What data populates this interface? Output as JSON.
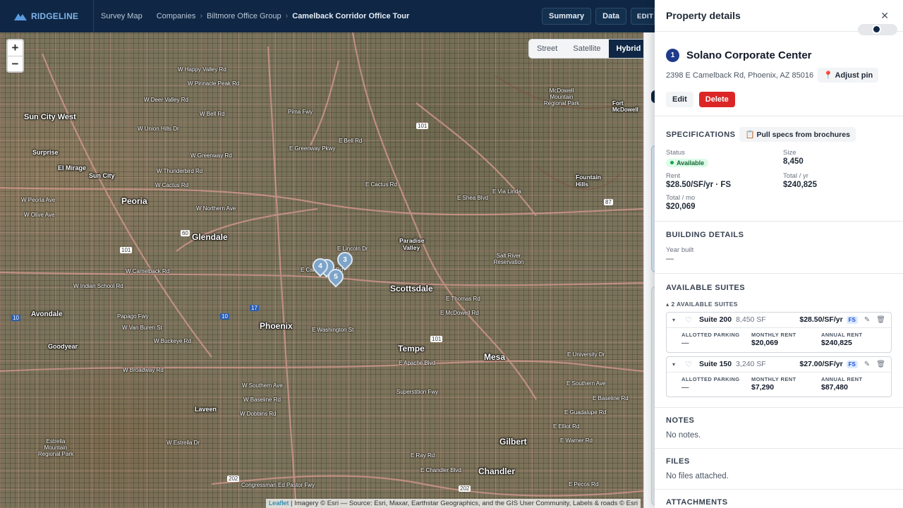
{
  "app": {
    "name": "RIDGELINE"
  },
  "breadcrumb": {
    "root": "Survey Map",
    "items": [
      "Companies",
      "Biltmore Office Group"
    ],
    "current": "Camelback Corridor Office Tour",
    "separator": "›"
  },
  "topbar": {
    "summary": "Summary",
    "data": "Data",
    "edit": "EDIT"
  },
  "map": {
    "zoom_in": "+",
    "zoom_out": "−",
    "layers": [
      "Street",
      "Satellite",
      "Hybrid"
    ],
    "active_layer": "Hybrid",
    "cities": [
      "Sun City West",
      "Surprise",
      "El Mirage",
      "Sun City",
      "Peoria",
      "Glendale",
      "Phoenix",
      "Avondale",
      "Goodyear",
      "Tempe",
      "Mesa",
      "Scottsdale",
      "Paradise Valley",
      "Gilbert",
      "Chandler",
      "Laveen",
      "Fort McDowell",
      "Fountain Hills"
    ],
    "streets": [
      "W Happy Valley Rd",
      "W Pinnacle Peak Rd",
      "W Deer Valley Rd",
      "W Union Hills Dr",
      "W Bell Rd",
      "W Greenway Rd",
      "W Thunderbird Rd",
      "W Cactus Rd",
      "W Peoria Ave",
      "W Olive Ave",
      "W Northern Ave",
      "W Camelback Rd",
      "W Indian School Rd",
      "Papago Fwy",
      "W Van Buren St",
      "W Buckeye Rd",
      "W Broadway Rd",
      "W Southern Ave",
      "W Baseline Rd",
      "W Dobbins Rd",
      "Congressman Ed Pastor Fwy",
      "E Camelback Rd",
      "E Lincoln Dr",
      "E Shea Blvd",
      "E Via Linda",
      "E Bell Rd",
      "E Cactus Rd",
      "E Thomas Rd",
      "E McDowell Rd",
      "E Washington St",
      "E Apache Blvd",
      "E University Dr",
      "E Southern Ave",
      "E Baseline Rd",
      "E Guadalupe Rd",
      "E Elliot Rd",
      "E Warner Rd",
      "E Ray Rd",
      "E Chandler Blvd",
      "E Pecos Rd",
      "Pima Fwy",
      "E Greenway Pkwy",
      "Superstition Fwy",
      "McDowell Mountain Regional Park",
      "Salt River Reservation",
      "Estrella Mountain Regional Park",
      "W Estrella Dr"
    ],
    "highway_shields": [
      "101",
      "101",
      "60",
      "10",
      "17",
      "10",
      "202",
      "87",
      "202",
      "101"
    ],
    "pins": [
      "3",
      "4",
      "5"
    ],
    "attribution_link": "Leaflet",
    "attribution": "| Imagery © Esri — Source: Esri, Maxar, Earthstar Geographics, and the GIS User Community, Labels & roads © Esri"
  },
  "panel": {
    "title": "Property details",
    "close": "✕",
    "property": {
      "number": "1",
      "name": "Solano Corporate Center",
      "address": "2398 E Camelback Rd, Phoenix, AZ 85016",
      "adjust_pin": "Adjust pin",
      "edit": "Edit",
      "delete": "Delete"
    },
    "specifications": {
      "title": "SPECIFICATIONS",
      "pull": "Pull specs from brochures",
      "status_label": "Status",
      "status_value": "Available",
      "size_label": "Size",
      "size_value": "8,450",
      "rent_label": "Rent",
      "rent_value": "$28.50/SF/yr · FS",
      "total_yr_label": "Total / yr",
      "total_yr_value": "$240,825",
      "total_mo_label": "Total / mo",
      "total_mo_value": "$20,069"
    },
    "building": {
      "title": "BUILDING DETAILS",
      "year_label": "Year built",
      "year_value": "—"
    },
    "suites": {
      "title": "AVAILABLE SUITES",
      "count": "2 AVAILABLE SUITES",
      "list": [
        {
          "name": "Suite 200",
          "sf": "8,450 SF",
          "rent": "$28.50/SF/yr",
          "type": "FS",
          "parking_label": "ALLOTTED PARKING",
          "parking": "—",
          "monthly_label": "MONTHLY RENT",
          "monthly": "$20,069",
          "annual_label": "ANNUAL RENT",
          "annual": "$240,825"
        },
        {
          "name": "Suite 150",
          "sf": "3,240 SF",
          "rent": "$27.00/SF/yr",
          "type": "FS",
          "parking_label": "ALLOTTED PARKING",
          "parking": "—",
          "monthly_label": "MONTHLY RENT",
          "monthly": "$7,290",
          "annual_label": "ANNUAL RENT",
          "annual": "$87,480"
        }
      ]
    },
    "notes": {
      "title": "NOTES",
      "empty": "No notes."
    },
    "files": {
      "title": "FILES",
      "empty": "No files attached."
    },
    "attachments": {
      "title": "ATTACHMENTS"
    }
  }
}
